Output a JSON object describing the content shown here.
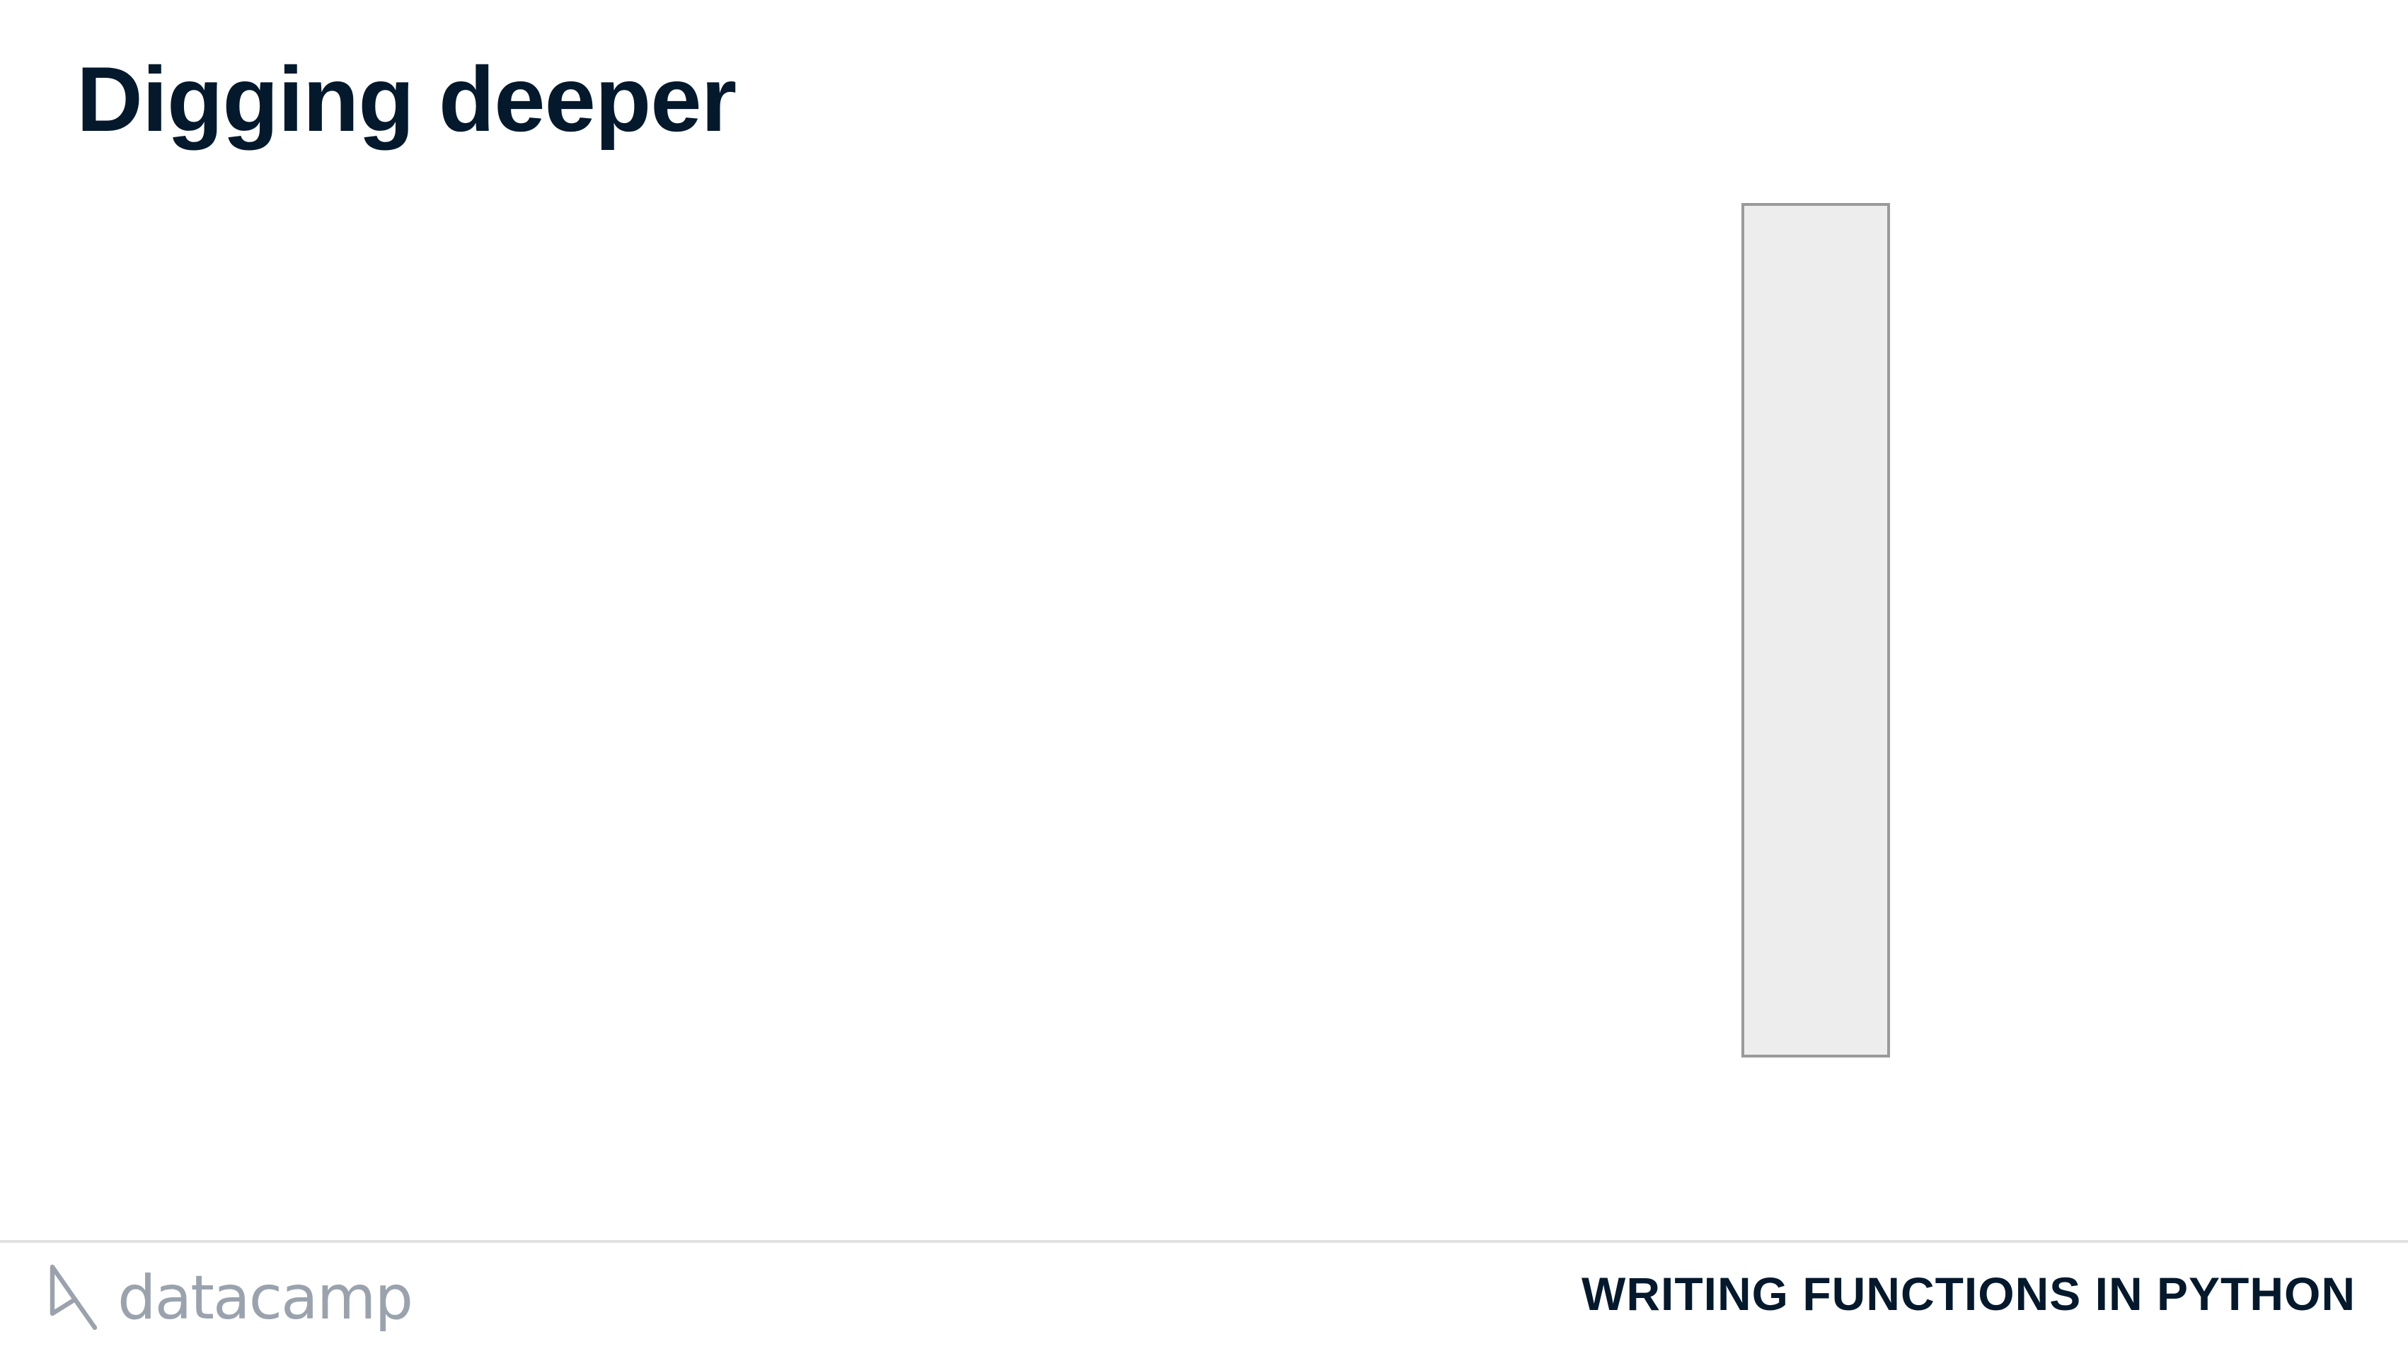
{
  "slide": {
    "title": "Digging deeper"
  },
  "footer": {
    "brand": "datacamp",
    "course": "WRITING FUNCTIONS IN PYTHON"
  },
  "colors": {
    "title": "#05192d",
    "brand": "#9aa3ad",
    "box_fill": "#ededed",
    "box_border": "#9a9a9a",
    "rule": "#e1e1e1"
  },
  "icons": {
    "logo": "datacamp-logo-icon"
  }
}
